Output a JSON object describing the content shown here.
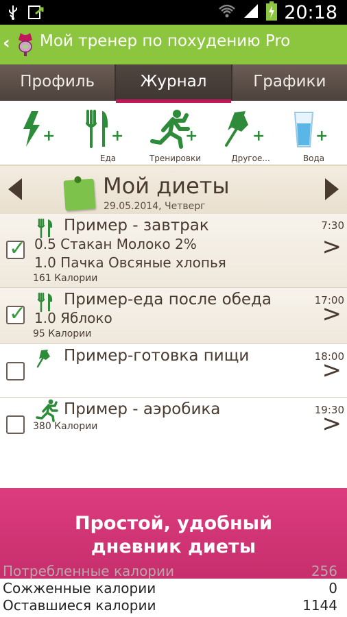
{
  "status_bar": {
    "time": "20:18",
    "icons": [
      "usb-icon",
      "sync-icon",
      "wifi-icon",
      "signal-icon",
      "battery-charging-icon"
    ]
  },
  "header": {
    "title": "Мой тренер по похудению Pro"
  },
  "tabs": [
    {
      "label": "Профиль",
      "active": false
    },
    {
      "label": "Журнал",
      "active": true
    },
    {
      "label": "Графики",
      "active": false
    }
  ],
  "quick_add": [
    {
      "icon": "flash-icon",
      "label": ""
    },
    {
      "icon": "fork-knife-icon",
      "label": "Еда"
    },
    {
      "icon": "runner-icon",
      "label": "Тренировки"
    },
    {
      "icon": "pushpin-icon",
      "label": "Другое..."
    },
    {
      "icon": "water-glass-icon",
      "label": "Вода"
    }
  ],
  "date_header": {
    "title": "Мой диеты",
    "date": "29.05.2014, Четверг"
  },
  "entries": [
    {
      "icon": "fork-knife-icon",
      "title": "Пример - завтрак",
      "time": "7:30",
      "checked": true,
      "lines": [
        "0.5 Стакан Молоко 2%",
        "1.0 Пачка Овсяные хлопья"
      ],
      "calories": "161 Калории"
    },
    {
      "icon": "fork-knife-icon",
      "title": "Пример-еда после обеда",
      "time": "17:00",
      "checked": true,
      "lines": [
        "1.0  Яблоко"
      ],
      "calories": "95 Калории"
    },
    {
      "icon": "pushpin-icon",
      "title": "Пример-готовка пищи",
      "time": "18:00",
      "checked": false,
      "lines": [],
      "calories": ""
    },
    {
      "icon": "runner-icon",
      "title": "Пример - аэробика",
      "time": "19:30",
      "checked": false,
      "lines": [],
      "calories": "380 Калории"
    }
  ],
  "banner": {
    "line1": "Простой, удобный",
    "line2": "дневник диеты"
  },
  "summary": [
    {
      "label": "Потребленные калории",
      "value": "256"
    },
    {
      "label": "Сожженные калории",
      "value": "0"
    },
    {
      "label": "Оставшиеся калории",
      "value": "1144"
    }
  ],
  "colors": {
    "accent_green": "#8cc63f",
    "icon_green": "#2e8b3a",
    "tab_bg": "#5a4d46",
    "tab_indicator": "#c2185b",
    "banner": "#d6367a",
    "text_brown": "#4a3b30"
  }
}
